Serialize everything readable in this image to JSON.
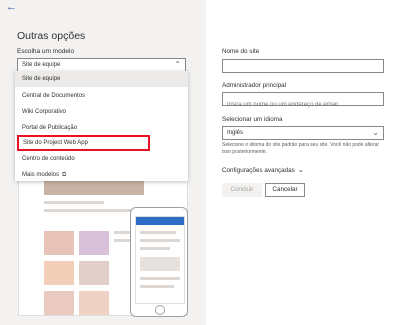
{
  "header": {
    "back_icon": "arrow-left-icon",
    "title": "Outras opções"
  },
  "template": {
    "label": "Escolha um modelo",
    "selected": "Site de equipe",
    "options": [
      {
        "label": "Site de equipe"
      },
      {
        "label": "Central de Documentos"
      },
      {
        "label": "Wiki Corporativo"
      },
      {
        "label": "Portal de Publicação"
      },
      {
        "label": "Site do Project Web App"
      },
      {
        "label": "Centro de conteúdo"
      },
      {
        "label": "Mais modelos",
        "icon": "external-link-icon"
      }
    ],
    "highlighted": "Site do Project Web App"
  },
  "form": {
    "site_name": {
      "label": "Nome do site",
      "value": "",
      "placeholder": ""
    },
    "admin": {
      "label": "Administrador principal",
      "value": "",
      "placeholder": "Insira um nome ou um endereço de email"
    },
    "language": {
      "label": "Selecionar um idioma",
      "value": "Inglês",
      "help": "Selecione o idioma do site padrão para seu site. Você não pode alterar isso posteriormente."
    },
    "advanced": "Configurações avançadas"
  },
  "buttons": {
    "finish": "Concluir",
    "cancel": "Cancelar"
  },
  "colors": {
    "accent": "#2b579a",
    "highlight_border": "#e81123",
    "pane_bg": "#f3f2f1"
  }
}
